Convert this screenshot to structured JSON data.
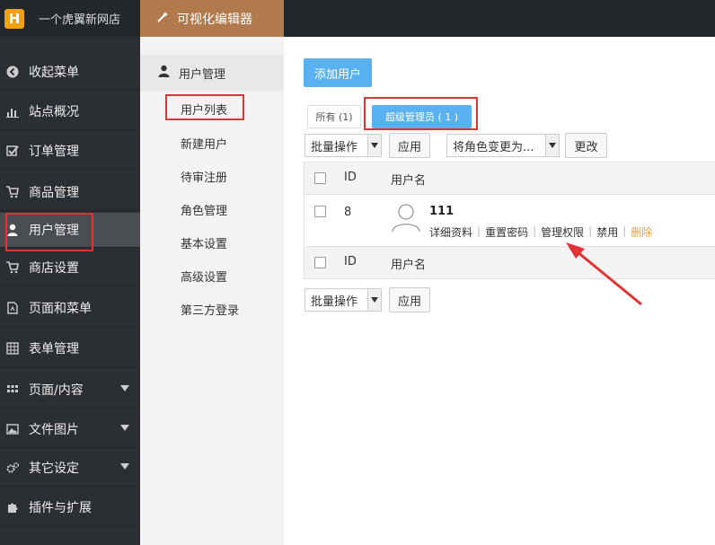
{
  "header": {
    "logo_letter": "H",
    "site_name": "一个虎翼新网店",
    "visual_editor": "可视化编辑器"
  },
  "sidebar": {
    "items": [
      {
        "label": "收起菜单",
        "icon": "collapse-left-icon"
      },
      {
        "label": "站点概况",
        "icon": "bar-chart-icon"
      },
      {
        "label": "订单管理",
        "icon": "checkbox-edit-icon"
      },
      {
        "label": "商品管理",
        "icon": "cart-icon"
      },
      {
        "label": "用户管理",
        "icon": "user-icon"
      },
      {
        "label": "商店设置",
        "icon": "cart-icon"
      },
      {
        "label": "页面和菜单",
        "icon": "page-icon"
      },
      {
        "label": "表单管理",
        "icon": "table-icon"
      },
      {
        "label": "页面/内容",
        "icon": "grid-icon"
      },
      {
        "label": "文件图片",
        "icon": "image-icon"
      },
      {
        "label": "其它设定",
        "icon": "gears-icon"
      },
      {
        "label": "插件与扩展",
        "icon": "puzzle-icon"
      }
    ]
  },
  "submenu": {
    "header": "用户管理",
    "items": [
      "用户列表",
      "新建用户",
      "待审注册",
      "角色管理",
      "基本设置",
      "高级设置",
      "第三方登录"
    ]
  },
  "main": {
    "add_user": "添加用户",
    "tab_all": "所有 (1)",
    "tab_super": "超级管理员 ( 1 )",
    "bulk_action": "批量操作",
    "apply": "应用",
    "change_role": "将角色变更为...",
    "change": "更改",
    "col_id": "ID",
    "col_username": "用户名",
    "row": {
      "id": "8",
      "username": "111",
      "actions": [
        "详细资料",
        "重置密码",
        "管理权限",
        "禁用",
        "删除"
      ]
    }
  },
  "colors": {
    "accent": "#5ab1ef",
    "editor_bg": "#b07a4c",
    "highlight": "#e03434",
    "delete": "#e8a13a"
  }
}
